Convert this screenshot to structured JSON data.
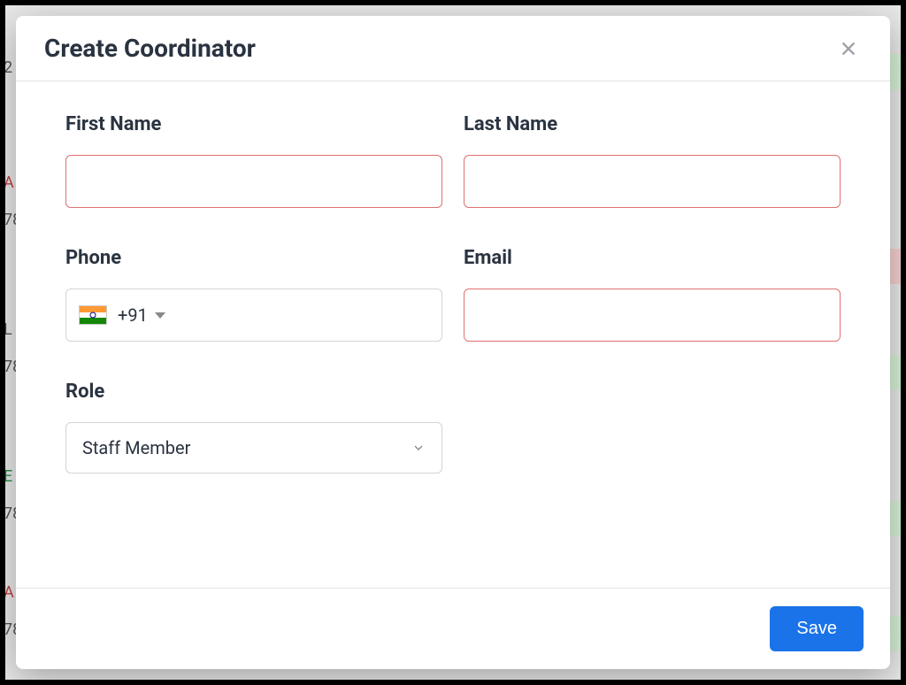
{
  "modal": {
    "title": "Create Coordinator",
    "fields": {
      "first_name": {
        "label": "First Name",
        "value": ""
      },
      "last_name": {
        "label": "Last Name",
        "value": ""
      },
      "phone": {
        "label": "Phone",
        "dial_code": "+91",
        "value": "",
        "country_flag": "india"
      },
      "email": {
        "label": "Email",
        "value": ""
      },
      "role": {
        "label": "Role",
        "selected": "Staff Member"
      }
    },
    "actions": {
      "save_label": "Save"
    }
  }
}
